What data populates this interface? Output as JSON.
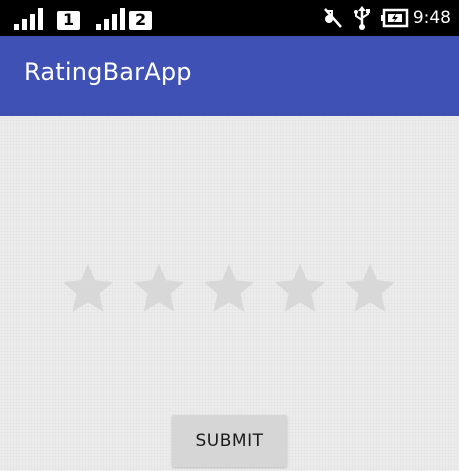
{
  "status_bar": {
    "sim1_label": "1",
    "sim2_label": "2",
    "time": "9:48",
    "icons": [
      "signal-icon",
      "signal-icon",
      "vibrate-off-icon",
      "usb-icon",
      "battery-charging-icon"
    ]
  },
  "app_bar": {
    "title": "RatingBarApp",
    "color": "#3f51b5"
  },
  "rating_bar": {
    "num_stars": 5,
    "rating": 0,
    "star_color": "#d8d8d8"
  },
  "submit_button": {
    "label": "SUBMIT"
  }
}
